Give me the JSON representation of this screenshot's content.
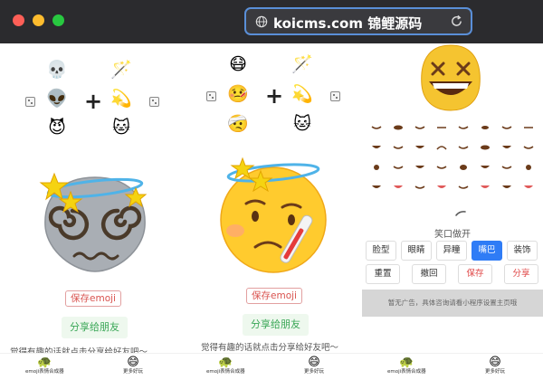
{
  "browser": {
    "url": "koicms.com 锦鲤源码"
  },
  "pane1": {
    "left_emojis": [
      "💀",
      "👽",
      "😈"
    ],
    "right_emojis": [
      "🪄",
      "💫",
      "🐱"
    ],
    "plus": "+",
    "save_label": "保存emoji",
    "share_label": "分享给朋友",
    "note": "觉得有趣的话就点击分享给好友吧～"
  },
  "pane2": {
    "left_emojis": [
      "😷",
      "🤒",
      "🤕"
    ],
    "right_emojis": [
      "🪄",
      "💫",
      "🐱"
    ],
    "plus": "+",
    "save_label": "保存emoji",
    "share_label": "分享给朋友",
    "note": "觉得有趣的话就点击分享给好友吧～"
  },
  "pane3": {
    "mouth_label": "笑口做开",
    "categories": [
      "脸型",
      "眼睛",
      "异瞳",
      "嘴巴",
      "装饰"
    ],
    "active_category": "嘴巴",
    "actions": [
      "重置",
      "撤回",
      "保存",
      "分享"
    ],
    "ad_text": "暂无广告，具体咨询请看小程序设置主页哦"
  },
  "tabbar": {
    "tab1": {
      "icon": "🐢",
      "label": "emoji表情合成器"
    },
    "tab2": {
      "icon": "😄",
      "label": "更多好玩"
    }
  },
  "colors": {
    "titlebar": "#2b2b2e",
    "url_border": "#5a8fd8",
    "accent_blue": "#2f7cf6",
    "share_green": "#3aa757",
    "save_red": "#d9534f"
  }
}
